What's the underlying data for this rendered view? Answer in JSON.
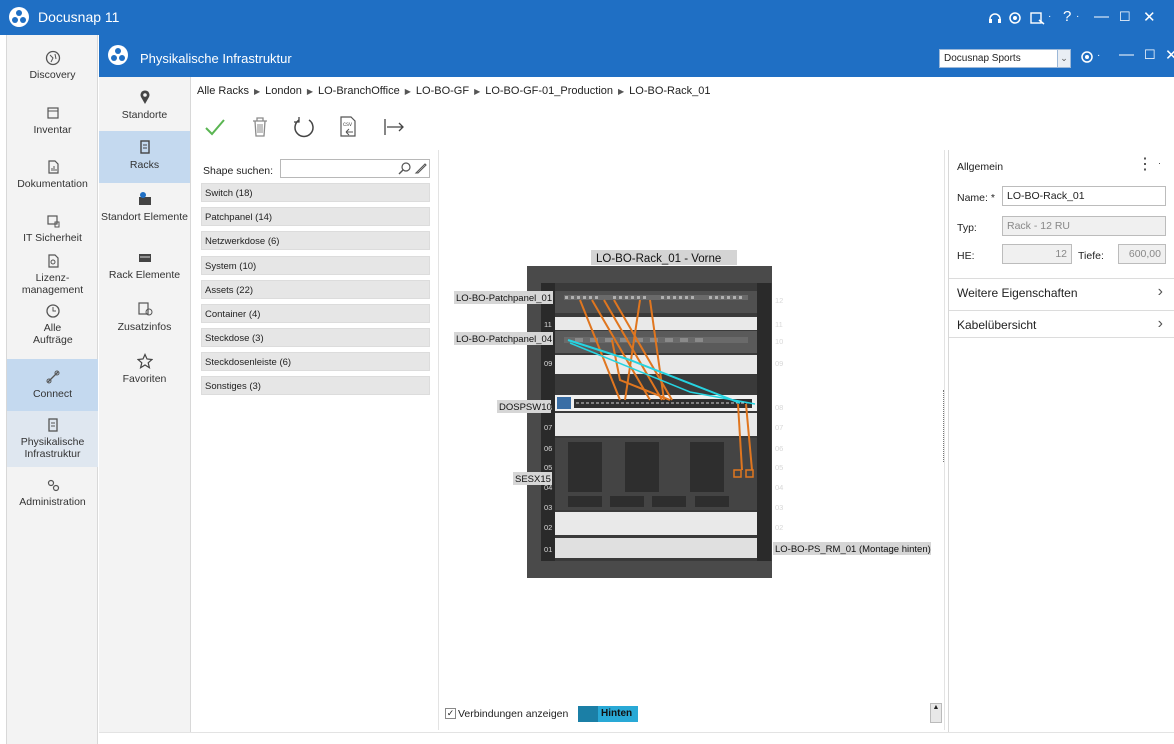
{
  "app": {
    "title": "Docusnap 11",
    "window_controls": [
      "?",
      "—",
      "☐",
      "✕"
    ]
  },
  "left_nav": {
    "items": [
      {
        "label": "Discovery",
        "icon": "globe-icon"
      },
      {
        "label": "Inventar",
        "icon": "inventory-icon"
      },
      {
        "label": "Dokumentation",
        "icon": "document-chart-icon"
      },
      {
        "label": "IT Sicherheit",
        "icon": "security-icon"
      },
      {
        "label": "Lizenz-management",
        "icon": "license-icon"
      },
      {
        "label": "Alle Aufträge",
        "icon": "clock-icon"
      },
      {
        "label": "Connect",
        "icon": "connect-icon",
        "selected": true
      },
      {
        "label": "Physikalische Infrastruktur",
        "icon": "rack-icon",
        "selected_light": true
      },
      {
        "label": "Administration",
        "icon": "gears-icon"
      }
    ]
  },
  "module": {
    "title": "Physikalische Infrastruktur",
    "tenant": "Docusnap Sports"
  },
  "sub_nav": {
    "items": [
      {
        "label": "Standorte",
        "icon": "location-pin-icon"
      },
      {
        "label": "Racks",
        "icon": "rack-icon",
        "selected": true
      },
      {
        "label": "Standort Elemente",
        "icon": "site-elements-icon"
      },
      {
        "label": "Rack Elemente",
        "icon": "rack-elements-icon"
      },
      {
        "label": "Zusatzinfos",
        "icon": "info-icon"
      },
      {
        "label": "Favoriten",
        "icon": "star-icon"
      }
    ]
  },
  "breadcrumb": [
    "Alle Racks",
    "London",
    "LO-BranchOffice",
    "LO-BO-GF",
    "LO-BO-GF-01_Production",
    "LO-BO-Rack_01"
  ],
  "shape_search": {
    "label": "Shape suchen:",
    "value": "",
    "categories": [
      "Switch (18)",
      "Patchpanel (14)",
      "Netzwerkdose (6)",
      "System (10)",
      "Assets (22)",
      "Container (4)",
      "Steckdose (3)",
      "Steckdosenleiste (6)",
      "Sonstiges (3)"
    ]
  },
  "rack": {
    "title": "LO-BO-Rack_01 - Vorne",
    "units": [
      "12",
      "11",
      "10",
      "09",
      "08",
      "07",
      "06",
      "05",
      "04",
      "03",
      "02",
      "01"
    ],
    "devices": {
      "patchpanel_01": "LO-BO-Patchpanel_01",
      "patchpanel_04": "LO-BO-Patchpanel_04",
      "switch": "DOSPSW10",
      "server": "SESX15",
      "power": "LO-BO-PS_RM_01 (Montage hinten)"
    },
    "colors": {
      "frame": "#3a3a3a",
      "cable_orange": "#e0761f",
      "cable_cyan": "#26d3e0"
    }
  },
  "properties": {
    "section": "Allgemein",
    "name_label": "Name: *",
    "name_value": "LO-BO-Rack_01",
    "type_label": "Typ:",
    "type_value": "Rack - 12 RU",
    "he_label": "HE:",
    "he_value": "12",
    "depth_label": "Tiefe:",
    "depth_value": "600,00",
    "more": "Weitere Eigenschaften",
    "cables": "Kabelübersicht"
  },
  "bottom": {
    "show_connections": "Verbindungen anzeigen",
    "toggle": "Hinten"
  }
}
